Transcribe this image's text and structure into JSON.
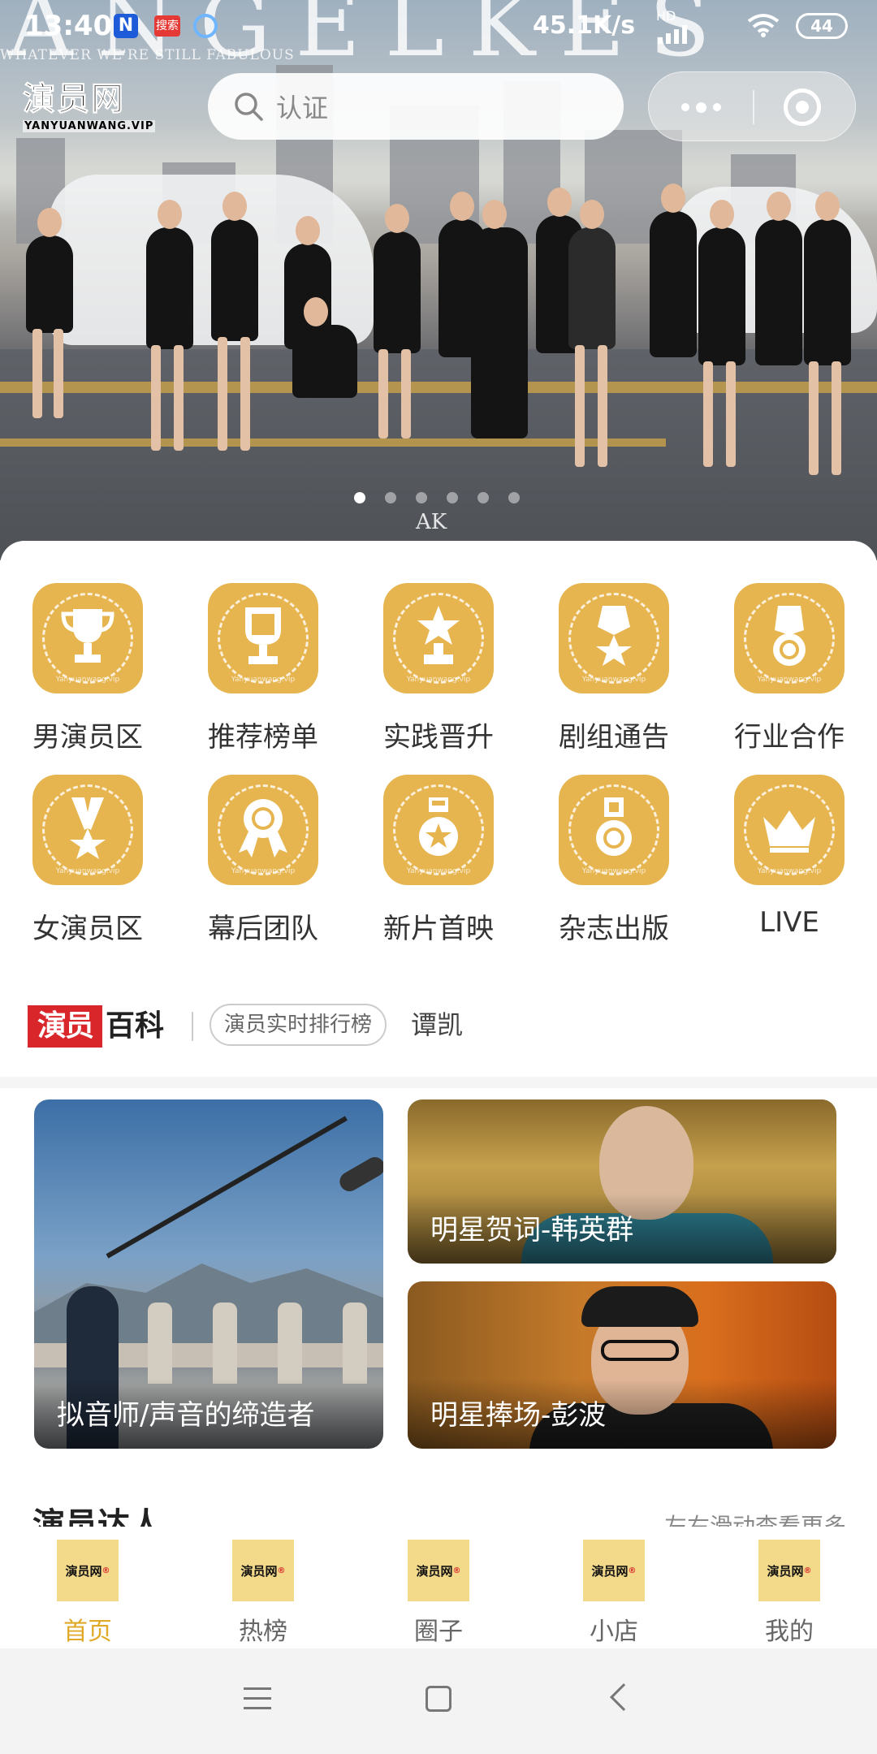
{
  "status_bar": {
    "time": "13:40",
    "notif_n": "N",
    "notif_s": "搜索",
    "speed": "45.1K/s",
    "network": "HD",
    "battery": "44"
  },
  "hero": {
    "overlay_letters": "ANGELKES",
    "slogan": "WHATEVER WE'RE STILL FABULOUS",
    "watermark": "AK",
    "slides": 6,
    "active_slide": 0
  },
  "header": {
    "logo_cn": "演员网",
    "logo_en": "YANYUANWANG.VIP",
    "search_placeholder": "认证"
  },
  "grid": {
    "watermark": "Yanyuanwang.vip",
    "items": [
      {
        "label": "男演员区",
        "icon": "trophy-icon"
      },
      {
        "label": "推荐榜单",
        "icon": "plaque-trophy-icon"
      },
      {
        "label": "实践晋升",
        "icon": "star-trophy-icon"
      },
      {
        "label": "剧组通告",
        "icon": "star-medal-icon"
      },
      {
        "label": "行业合作",
        "icon": "ring-medal-icon"
      },
      {
        "label": "女演员区",
        "icon": "ribbon-star-medal-icon"
      },
      {
        "label": "幕后团队",
        "icon": "rosette-icon"
      },
      {
        "label": "新片首映",
        "icon": "badge-star-icon"
      },
      {
        "label": "杂志出版",
        "icon": "medal-icon"
      },
      {
        "label": "LIVE",
        "icon": "crown-icon"
      }
    ]
  },
  "wiki": {
    "logo_red": "演员",
    "logo_black": "百科",
    "tag": "演员实时排行榜",
    "name": "谭凯"
  },
  "cards": [
    {
      "caption": "拟音师/声音的缔造者"
    },
    {
      "caption": "明星贺词-韩英群"
    },
    {
      "caption": "明星捧场-彭波"
    }
  ],
  "talent": {
    "title": "演员达人",
    "hint": "左右滑动查看更多"
  },
  "tabbar": {
    "icon_text": "演员网",
    "items": [
      {
        "label": "首页",
        "active": true
      },
      {
        "label": "热榜",
        "active": false
      },
      {
        "label": "圈子",
        "active": false
      },
      {
        "label": "小店",
        "active": false
      },
      {
        "label": "我的",
        "active": false
      }
    ]
  },
  "colors": {
    "accent_gold": "#e7b54f",
    "active_tab": "#e0a928",
    "wiki_red": "#d9262b"
  }
}
